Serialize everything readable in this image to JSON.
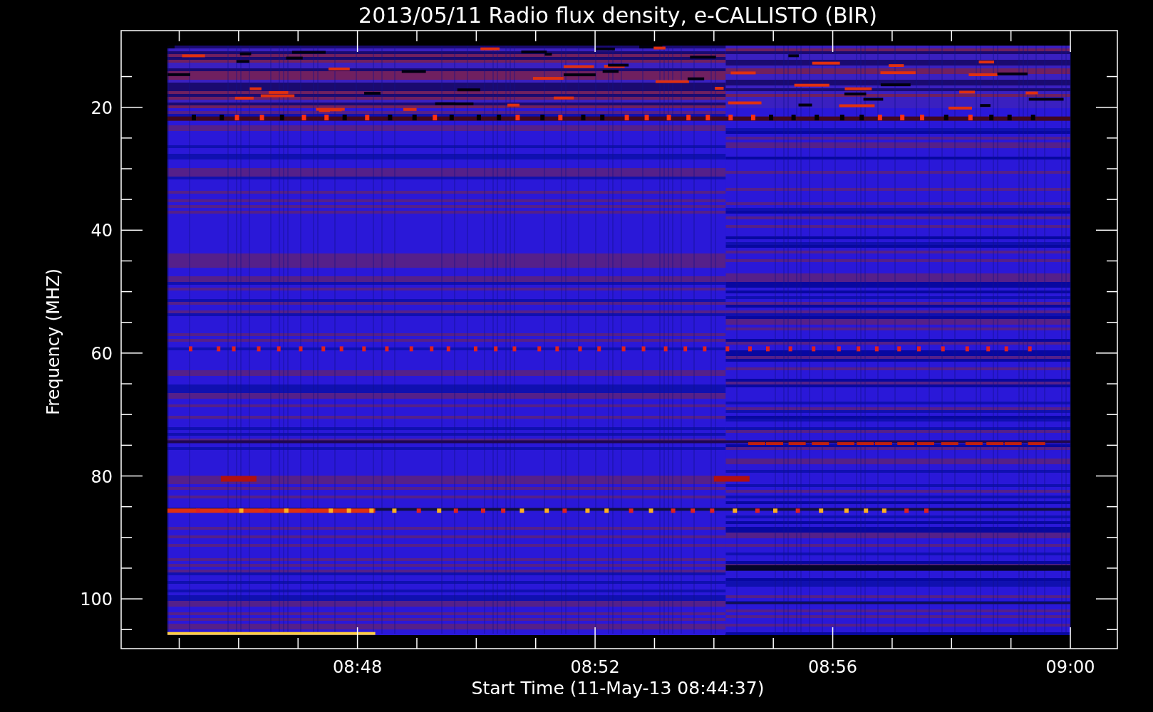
{
  "title": "2013/05/11  Radio flux density, e-CALLISTO (BIR)",
  "y_axis": {
    "label": "Frequency (MHZ)",
    "ticks": [
      "20",
      "40",
      "60",
      "80",
      "100"
    ]
  },
  "x_axis": {
    "label": "Start Time (11-May-13 08:44:37)",
    "ticks": [
      "08:48",
      "08:52",
      "08:56",
      "09:00"
    ]
  }
}
